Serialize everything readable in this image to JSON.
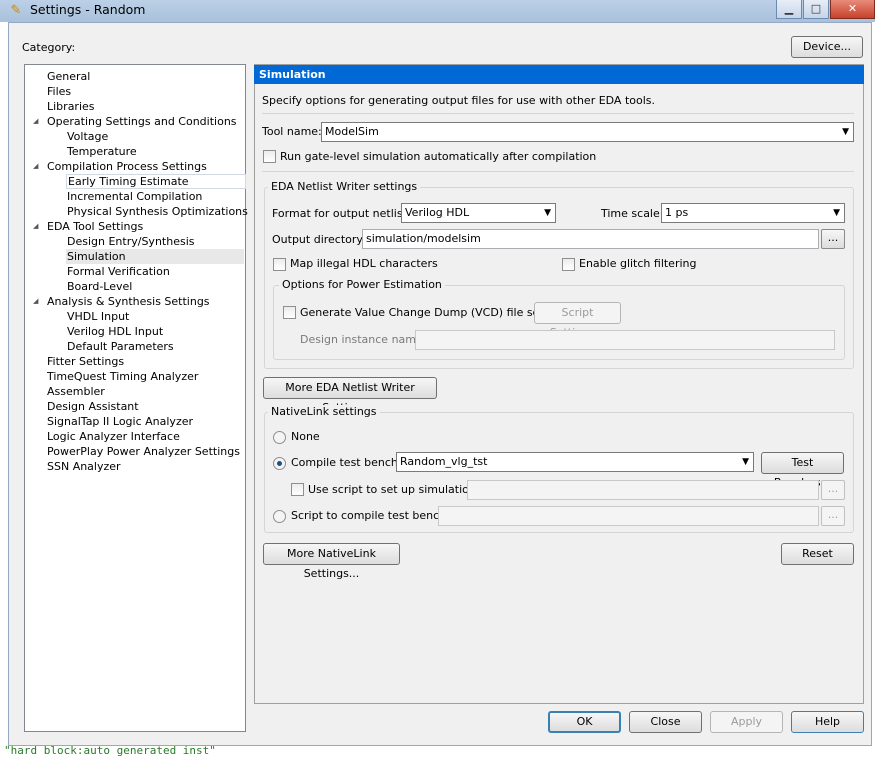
{
  "window": {
    "title": "Settings - Random",
    "minimize": "▁",
    "maximize": "□",
    "close": "✕",
    "icon": "settings-pen-icon"
  },
  "background_text": "\"hard block:auto generated inst\"",
  "category_label": "Category:",
  "device_button": "Device...",
  "tree": [
    {
      "label": "General",
      "level": 0
    },
    {
      "label": "Files",
      "level": 0
    },
    {
      "label": "Libraries",
      "level": 0
    },
    {
      "label": "Operating Settings and Conditions",
      "level": 0
    },
    {
      "label": "Voltage",
      "level": 1
    },
    {
      "label": "Temperature",
      "level": 1
    },
    {
      "label": "Compilation Process Settings",
      "level": 0
    },
    {
      "label": "Early Timing Estimate",
      "level": 1
    },
    {
      "label": "Incremental Compilation",
      "level": 1
    },
    {
      "label": "Physical Synthesis Optimizations",
      "level": 1
    },
    {
      "label": "EDA Tool Settings",
      "level": 0
    },
    {
      "label": "Design Entry/Synthesis",
      "level": 1
    },
    {
      "label": "Simulation",
      "level": 1
    },
    {
      "label": "Formal Verification",
      "level": 1
    },
    {
      "label": "Board-Level",
      "level": 1
    },
    {
      "label": "Analysis & Synthesis Settings",
      "level": 0
    },
    {
      "label": "VHDL Input",
      "level": 1
    },
    {
      "label": "Verilog HDL Input",
      "level": 1
    },
    {
      "label": "Default Parameters",
      "level": 1
    },
    {
      "label": "Fitter Settings",
      "level": 0
    },
    {
      "label": "TimeQuest Timing Analyzer",
      "level": 0
    },
    {
      "label": "Assembler",
      "level": 0
    },
    {
      "label": "Design Assistant",
      "level": 0
    },
    {
      "label": "SignalTap II Logic Analyzer",
      "level": 0
    },
    {
      "label": "Logic Analyzer Interface",
      "level": 0
    },
    {
      "label": "PowerPlay Power Analyzer Settings",
      "level": 0
    },
    {
      "label": "SSN Analyzer",
      "level": 0
    }
  ],
  "panel": {
    "title": "Simulation",
    "description": "Specify options for generating output files for use with other EDA tools.",
    "tool_name_label": "Tool name:",
    "tool_name_value": "ModelSim",
    "run_gate_level": "Run gate-level simulation automatically after compilation",
    "eda_group": "EDA Netlist Writer settings",
    "format_label": "Format for output netlist:",
    "format_value": "Verilog HDL",
    "timescale_label": "Time scale:",
    "timescale_value": "1 ps",
    "output_dir_label": "Output directory:",
    "output_dir_value": "simulation/modelsim",
    "browse": "...",
    "map_illegal": "Map illegal HDL characters",
    "enable_glitch": "Enable glitch filtering",
    "power_group": "Options for Power Estimation",
    "generate_vcd": "Generate Value Change Dump (VCD) file script",
    "script_settings": "Script Settings...",
    "design_instance_label": "Design instance name:",
    "more_eda": "More EDA Netlist Writer Settings...",
    "nativelink_group": "NativeLink settings",
    "none": "None",
    "compile_tb": "Compile test bench:",
    "compile_tb_value": "Random_vlg_tst",
    "test_benches": "Test Benches...",
    "use_script": "Use script to set up simulation:",
    "script_compile": "Script to compile test bench:",
    "more_nativelink": "More NativeLink Settings...",
    "reset": "Reset"
  },
  "footer": {
    "ok": "OK",
    "close": "Close",
    "apply": "Apply",
    "help": "Help"
  }
}
